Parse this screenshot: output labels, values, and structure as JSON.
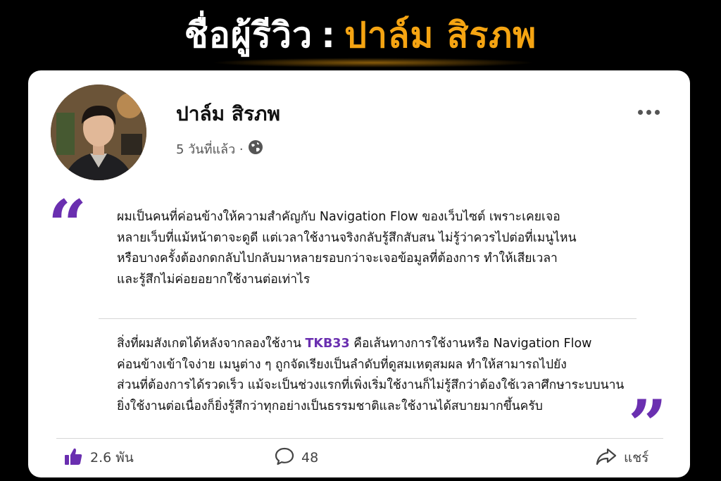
{
  "headline": {
    "label": "ชื่อผู้รีวิว",
    "separator": ":",
    "reviewer_name": "ปาล์ม สิรภพ"
  },
  "post": {
    "author_name": "ปาล์ม สิรภพ",
    "time_ago": "5 วันที่แล้ว ·",
    "privacy_icon": "globe-icon",
    "paragraph1_lines": [
      "ผมเป็นคนที่ค่อนข้างให้ความสำคัญกับ Navigation Flow ของเว็บไซต์ เพราะเคยเจอ",
      "หลายเว็บที่แม้หน้าตาจะดูดี แต่เวลาใช้งานจริงกลับรู้สึกสับสน ไม่รู้ว่าควรไปต่อที่เมนูไหน",
      "หรือบางครั้งต้องกดกลับไปกลับมาหลายรอบกว่าจะเจอข้อมูลที่ต้องการ ทำให้เสียเวลา",
      "และรู้สึกไม่ค่อยอยากใช้งานต่อเท่าไร"
    ],
    "paragraph2": {
      "line1_before": "สิ่งที่ผมสังเกตได้หลังจากลองใช้งาน ",
      "brand": "TKB33",
      "line1_after": " คือเส้นทางการใช้งานหรือ Navigation Flow",
      "lines": [
        "ค่อนข้างเข้าใจง่าย เมนูต่าง ๆ ถูกจัดเรียงเป็นลำดับที่ดูสมเหตุสมผล ทำให้สามารถไปยัง",
        "ส่วนที่ต้องการได้รวดเร็ว แม้จะเป็นช่วงแรกที่เพิ่งเริ่มใช้งานก็ไม่รู้สึกว่าต้องใช้เวลาศึกษาระบบนาน",
        "ยิ่งใช้งานต่อเนื่องก็ยิ่งรู้สึกว่าทุกอย่างเป็นธรรมชาติและใช้งานได้สบายมากขึ้นครับ"
      ]
    },
    "quote_open": "“",
    "quote_close": "”"
  },
  "actions": {
    "likes": "2.6 พัน",
    "comments": "48",
    "share_label": "แชร์"
  },
  "colors": {
    "accent_purple": "#6a2fb0",
    "headline_orange": "#f5a412",
    "background": "#000000",
    "card": "#ffffff"
  }
}
